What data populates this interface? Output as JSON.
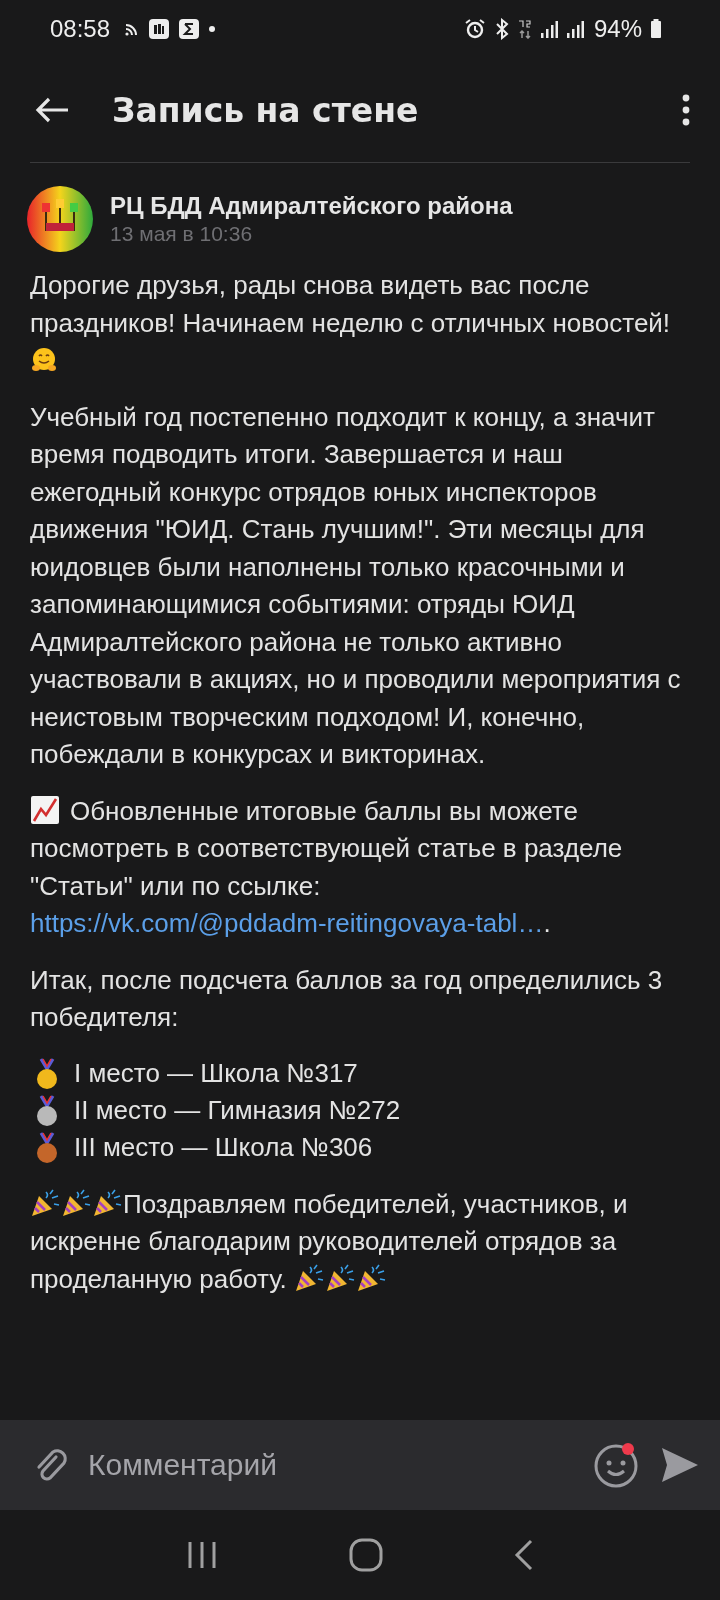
{
  "status_bar": {
    "time": "08:58",
    "battery": "94%"
  },
  "header": {
    "title": "Запись на стене"
  },
  "post": {
    "author": "РЦ БДД Адмиралтейского района",
    "date": "13 мая в 10:36",
    "paragraphs": [
      {
        "kind": "lead",
        "text": "Дорогие друзья, рады снова видеть вас после праздников! Начинаем неделю с отличных новостей!"
      },
      {
        "kind": "plain",
        "text": "Учебный год постепенно подходит к концу, а значит время подводить итоги. Завершается и наш ежегодный конкурс отрядов юных инспекторов движения \"ЮИД. Стань лучшим!\". Эти месяцы для юидовцев были наполнены только красочными и запоминающимися событиями: отряды ЮИД Адмиралтейского района не только активно участвовали в акциях, но и проводили мероприятия с неистовым творческим подходом! И, конечно, побеждали в конкурсах и викторинах."
      },
      {
        "kind": "chart",
        "text": "Обновленные итоговые баллы вы можете посмотреть в соответствующей статье в разделе \"Статьи\" или по ссылке:",
        "link": "https://vk.com/@pddadm-reitingovaya-tabl…",
        "after": "."
      },
      {
        "kind": "plain",
        "text": "Итак, после подсчета баллов за год определились 3 победителя:"
      },
      {
        "kind": "places",
        "items": [
          {
            "text": "I место — Школа №317",
            "color": "#f0b81c"
          },
          {
            "text": "II место — Гимназия №272",
            "color": "#b9b9b9"
          },
          {
            "text": "III место — Школа №306",
            "color": "#c4662a"
          }
        ]
      },
      {
        "kind": "congrats",
        "text": "Поздравляем победителей, участников, и искренне благодарим руководителей отрядов за проделанную работу."
      }
    ]
  },
  "comment": {
    "placeholder": "Комментарий"
  }
}
